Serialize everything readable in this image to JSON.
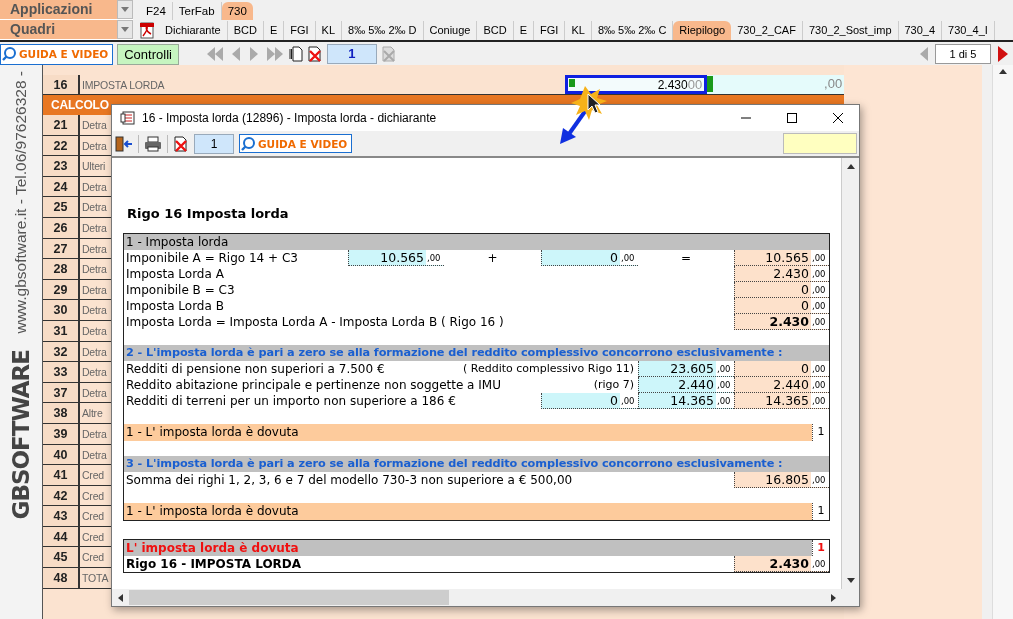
{
  "app_menus": [
    {
      "label": "Applicazioni"
    },
    {
      "label": "Quadri"
    }
  ],
  "module_tabs": [
    {
      "label": "F24",
      "selected": false
    },
    {
      "label": "TerFab",
      "selected": false
    },
    {
      "label": "730",
      "selected": true
    }
  ],
  "form_tabs": [
    {
      "label": "Dichiarante",
      "selected": false
    },
    {
      "label": "BCD",
      "selected": false
    },
    {
      "label": "E",
      "selected": false
    },
    {
      "label": "FGI",
      "selected": false
    },
    {
      "label": "KL",
      "selected": false
    },
    {
      "label": "8‰ 5‰ 2‰ D",
      "selected": false
    },
    {
      "label": "Coniuge",
      "selected": false
    },
    {
      "label": "BCD",
      "selected": false
    },
    {
      "label": "E",
      "selected": false
    },
    {
      "label": "FGI",
      "selected": false
    },
    {
      "label": "KL",
      "selected": false
    },
    {
      "label": "8‰ 5‰ 2‰ C",
      "selected": false
    },
    {
      "label": "Riepilogo",
      "selected": true
    },
    {
      "label": "730_2_CAF",
      "selected": false
    },
    {
      "label": "730_2_Sost_imp",
      "selected": false
    },
    {
      "label": "730_4",
      "selected": false
    },
    {
      "label": "730_4_I",
      "selected": false
    }
  ],
  "toolbar": {
    "guide_button": "GUIDA E VIDEO",
    "checks_button": "Controlli",
    "record": "1",
    "pager": "1 di 5"
  },
  "sidebar": {
    "contact": "www.gbsoftware.it - Tel.06/97626328 -",
    "brand": "GBSOFTWARE"
  },
  "sheet": {
    "current_row": {
      "number": "16",
      "label": "IMPOSTA LORDA",
      "value": "2.430",
      "decimals": "00",
      "spouse_decimals": ",00"
    },
    "section_title": "CALCOLO",
    "rows": [
      {
        "number": "21",
        "label": "Detra"
      },
      {
        "number": "22",
        "label": "Detra"
      },
      {
        "number": "23",
        "label": "Ulteri"
      },
      {
        "number": "24",
        "label": "Detra"
      },
      {
        "number": "25",
        "label": "Detra"
      },
      {
        "number": "26",
        "label": "Detra"
      },
      {
        "number": "27",
        "label": "Detra"
      },
      {
        "number": "28",
        "label": "Detra"
      },
      {
        "number": "29",
        "label": "Detra"
      },
      {
        "number": "30",
        "label": "Detra"
      },
      {
        "number": "31",
        "label": "Detra"
      },
      {
        "number": "32",
        "label": "Detra"
      },
      {
        "number": "33",
        "label": "Detra"
      },
      {
        "number": "37",
        "label": "Detra"
      },
      {
        "number": "38",
        "label": "Altre"
      },
      {
        "number": "39",
        "label": "Detra"
      },
      {
        "number": "40",
        "label": "Detra"
      },
      {
        "number": "41",
        "label": "Cred"
      },
      {
        "number": "42",
        "label": "Cred"
      },
      {
        "number": "43",
        "label": "Cred"
      },
      {
        "number": "44",
        "label": "Cred"
      },
      {
        "number": "45",
        "label": "Cred"
      },
      {
        "number": "48",
        "label": "TOTA"
      }
    ]
  },
  "dialog": {
    "title": "16 - Imposta lorda (12896) - Imposta lorda - dichiarante",
    "record": "1",
    "guide_button": "GUIDA E VIDEO",
    "heading": "Rigo 16 Imposta lorda",
    "main_rows": [
      {
        "kind": "header",
        "text": "1 - Imposta lorda"
      },
      {
        "kind": "formula",
        "label": "Imponibile A = Rigo 14 + C3",
        "a": {
          "value": "10.565",
          "decimals": ",00",
          "kind": "input"
        },
        "op1": "+",
        "b": {
          "value": "0",
          "decimals": ",00",
          "kind": "input"
        },
        "op2": "=",
        "result": {
          "value": "10.565",
          "decimals": ",00",
          "kind": "output"
        }
      },
      {
        "kind": "value",
        "label": "Imposta Lorda A",
        "result": {
          "value": "2.430",
          "decimals": ",00",
          "kind": "output"
        }
      },
      {
        "kind": "value",
        "label": "Imponibile B = C3",
        "result": {
          "value": "0",
          "decimals": ",00",
          "kind": "output"
        }
      },
      {
        "kind": "value",
        "label": "Imposta Lorda B",
        "result": {
          "value": "0",
          "decimals": ",00",
          "kind": "output"
        }
      },
      {
        "kind": "value",
        "label": "Imposta Lorda = Imposta Lorda A - Imposta Lorda B ( Rigo 16 )",
        "result": {
          "value": "2.430",
          "decimals": ",00",
          "kind": "output",
          "bold": true
        }
      },
      {
        "kind": "spacer"
      },
      {
        "kind": "section",
        "text": "2 - L'imposta lorda è pari a zero se alla formazione del reddito complessivo concorrono esclusivamente :"
      },
      {
        "kind": "detail",
        "label": "Redditi di pensione non superiori a 7.500 €",
        "note": "( Reddito complessivo Rigo 11)",
        "mid": {
          "value": "23.605",
          "decimals": ",00",
          "kind": "input"
        },
        "result": {
          "value": "0",
          "decimals": ",00",
          "kind": "output"
        }
      },
      {
        "kind": "detail",
        "label": "Reddito abitazione principale e pertinenze non soggette a IMU",
        "note": "(rigo 7)",
        "mid": {
          "value": "2.440",
          "decimals": ",00",
          "kind": "input"
        },
        "result": {
          "value": "2.440",
          "decimals": ",00",
          "kind": "output"
        }
      },
      {
        "kind": "detail",
        "label": "Redditi di terreni per un importo non superiore a 186 €",
        "input": {
          "value": "0",
          "decimals": ",00",
          "kind": "input"
        },
        "mid": {
          "value": "14.365",
          "decimals": ",00",
          "kind": "input"
        },
        "result": {
          "value": "14.365",
          "decimals": ",00",
          "kind": "output"
        }
      },
      {
        "kind": "spacer"
      },
      {
        "kind": "outcome",
        "text": "1 - L' imposta lorda è dovuta",
        "flag": "1"
      },
      {
        "kind": "spacer"
      },
      {
        "kind": "section",
        "text": "3 - L'imposta lorda è pari a zero se alla formazione del reddito complessivo concorrono esclusivamente :"
      },
      {
        "kind": "value",
        "label": "Somma dei righi 1, 2, 3, 6 e 7 del modello 730-3 non superiore a € 500,00",
        "result": {
          "value": "16.805",
          "decimals": ",00",
          "kind": "output"
        }
      },
      {
        "kind": "spacer"
      },
      {
        "kind": "outcome",
        "text": "1 - L' imposta lorda è dovuta",
        "flag": "1"
      }
    ],
    "summary_rows": [
      {
        "kind": "alert",
        "text": "L' imposta lorda è dovuta",
        "flag": "1"
      },
      {
        "kind": "total",
        "label": "Rigo 16 - IMPOSTA LORDA",
        "result": {
          "value": "2.430",
          "decimals": ",00",
          "kind": "output",
          "bold": true
        }
      }
    ]
  }
}
